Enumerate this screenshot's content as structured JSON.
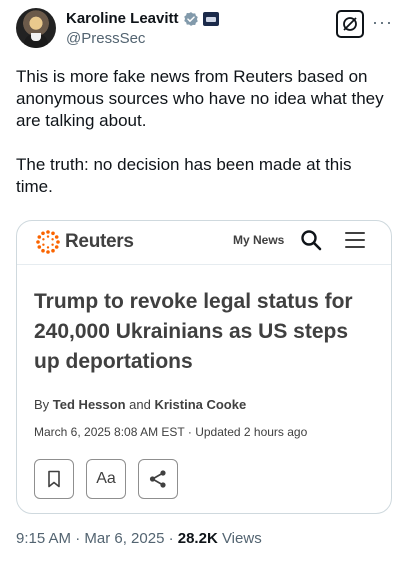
{
  "author": {
    "display_name": "Karoline Leavitt",
    "handle": "@PressSec"
  },
  "tweet": {
    "paragraph_1": "This is more fake news from Reuters based on anonymous sources who have no idea what they are talking about.",
    "paragraph_2": "The truth: no decision has been made at this time."
  },
  "card": {
    "brand": "Reuters",
    "nav_my_news": "My News",
    "headline": "Trump to revoke legal status for 240,000 Ukrainians as US steps up deportations",
    "byline_prefix": "By",
    "author_1": "Ted Hesson",
    "byline_and": "and",
    "author_2": "Kristina Cooke",
    "date": "March 6, 2025 8:08 AM EST · Updated 2 hours ago",
    "text_size_label": "Aa"
  },
  "footer": {
    "time": "9:15 AM · Mar 6, 2025 ·",
    "views_count": "28.2K",
    "views_label": "Views"
  },
  "colors": {
    "verified": "#829aab",
    "reuters_orange": "#fa6400",
    "text_primary": "#0f1419",
    "text_secondary": "#536471"
  }
}
